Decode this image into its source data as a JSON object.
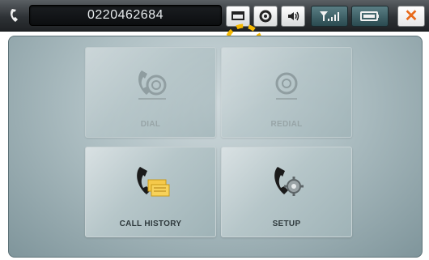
{
  "header": {
    "phone_number": "0220462684",
    "buttons": [
      {
        "icon": "window-icon"
      },
      {
        "icon": "ring-icon"
      },
      {
        "icon": "speaker-icon"
      },
      {
        "icon": "signal-icon"
      },
      {
        "icon": "battery-icon"
      },
      {
        "icon": "close-icon"
      }
    ]
  },
  "menu": {
    "dial_label": "DIAL",
    "redial_label": "REDIAL",
    "call_history_label": "CALL HISTORY",
    "setup_label": "SETUP"
  },
  "colors": {
    "accent": "#f5b800",
    "close": "#e86a1a"
  }
}
